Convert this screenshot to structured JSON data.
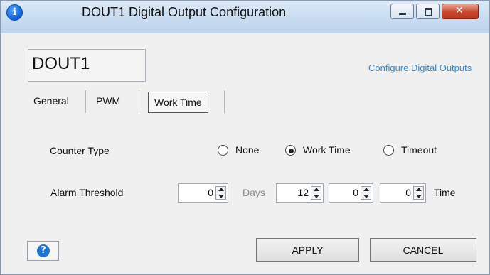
{
  "window": {
    "title": "DOUT1 Digital Output Configuration",
    "icon": "info-icon"
  },
  "output_name": "DOUT1",
  "config_link": "Configure Digital Outputs",
  "tabs": [
    {
      "label": "General",
      "active": false
    },
    {
      "label": "PWM",
      "active": false
    },
    {
      "label": "Work Time",
      "active": true
    }
  ],
  "counter_type": {
    "label": "Counter Type",
    "options": [
      {
        "label": "None",
        "selected": false
      },
      {
        "label": "Work Time",
        "selected": true
      },
      {
        "label": "Timeout",
        "selected": false
      }
    ]
  },
  "alarm_threshold": {
    "label": "Alarm Threshold",
    "days_value": "0",
    "days_label": "Days",
    "hours_value": "12",
    "minutes_value": "0",
    "seconds_value": "0",
    "time_label": "Time"
  },
  "buttons": {
    "apply": "APPLY",
    "cancel": "CANCEL",
    "help_icon": "help-icon"
  },
  "colors": {
    "link": "#2d8bd8",
    "days_label": "#8a8a8a",
    "close_button": "#c8462e"
  }
}
